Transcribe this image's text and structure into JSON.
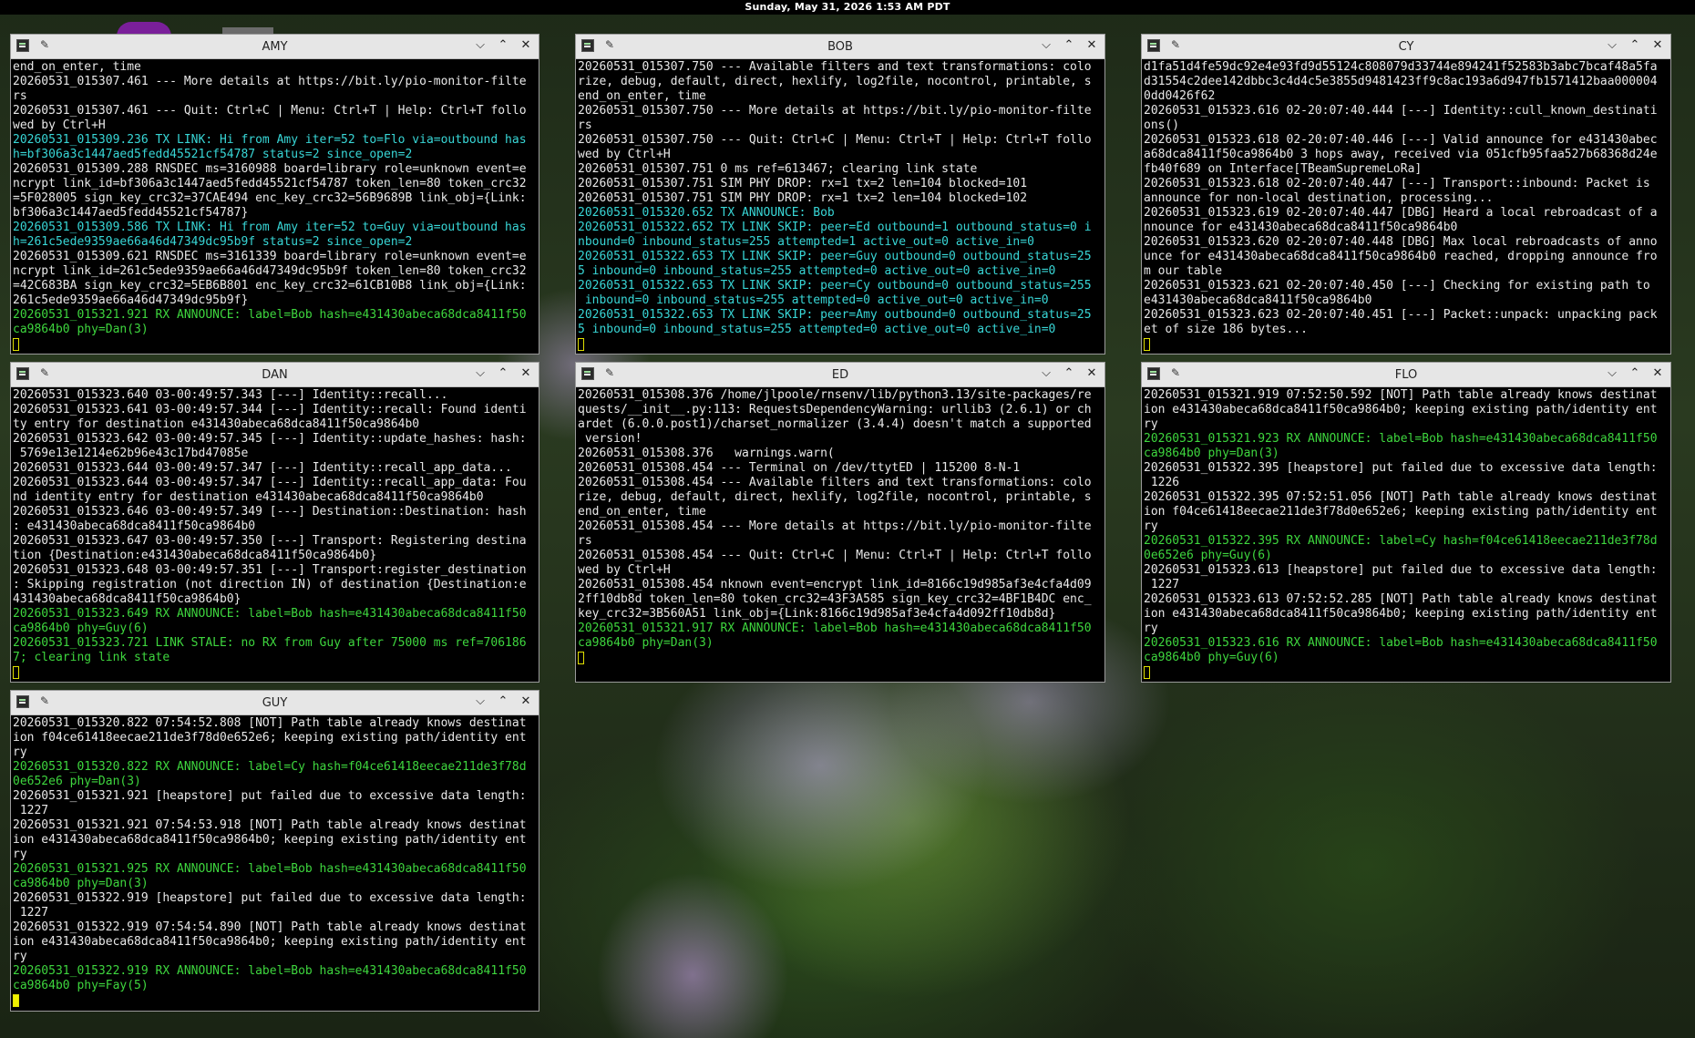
{
  "topbar": {
    "datetime": "Sunday, May 31, 2026  1:53 AM PDT"
  },
  "colors": {
    "cyan": "#38d6d6",
    "green": "#3ed63e",
    "cursor": "#f0f000"
  },
  "icons": [
    "terminal-icon",
    "pin-icon",
    "minimize-icon",
    "maximize-icon",
    "close-icon"
  ],
  "window_controls": {
    "minimize": "⌵",
    "maximize": "⌃",
    "close": "✕",
    "pin": "✎"
  },
  "windows": {
    "amy": {
      "title": "AMY",
      "lines": [
        {
          "t": "end_on_enter, time",
          "c": ""
        },
        {
          "t": "20260531_015307.461 --- More details at https://bit.ly/pio-monitor-filte",
          "c": ""
        },
        {
          "t": "rs",
          "c": ""
        },
        {
          "t": "20260531_015307.461 --- Quit: Ctrl+C | Menu: Ctrl+T | Help: Ctrl+T follo",
          "c": ""
        },
        {
          "t": "wed by Ctrl+H",
          "c": ""
        },
        {
          "t": "20260531_015309.236 TX LINK: Hi from Amy iter=52 to=Flo via=outbound has",
          "c": "c"
        },
        {
          "t": "h=bf306a3c1447aed5fedd45521cf54787 status=2 since_open=2",
          "c": "c"
        },
        {
          "t": "20260531_015309.288 RNSDEC ms=3160988 board=library role=unknown event=e",
          "c": ""
        },
        {
          "t": "ncrypt link_id=bf306a3c1447aed5fedd45521cf54787 token_len=80 token_crc32",
          "c": ""
        },
        {
          "t": "=5F028005 sign_key_crc32=37CAE494 enc_key_crc32=56B9689B link_obj={Link:",
          "c": ""
        },
        {
          "t": "bf306a3c1447aed5fedd45521cf54787}",
          "c": ""
        },
        {
          "t": "20260531_015309.586 TX LINK: Hi from Amy iter=52 to=Guy via=outbound has",
          "c": "c"
        },
        {
          "t": "h=261c5ede9359ae66a46d47349dc95b9f status=2 since_open=2",
          "c": "c"
        },
        {
          "t": "20260531_015309.621 RNSDEC ms=3161339 board=library role=unknown event=e",
          "c": ""
        },
        {
          "t": "ncrypt link_id=261c5ede9359ae66a46d47349dc95b9f token_len=80 token_crc32",
          "c": ""
        },
        {
          "t": "=42C683BA sign_key_crc32=5EB6B801 enc_key_crc32=61CB10B8 link_obj={Link:",
          "c": ""
        },
        {
          "t": "261c5ede9359ae66a46d47349dc95b9f}",
          "c": ""
        },
        {
          "t": "20260531_015321.921 RX ANNOUNCE: label=Bob hash=e431430abeca68dca8411f50",
          "c": "g"
        },
        {
          "t": "ca9864b0 phy=Dan(3)",
          "c": "g"
        }
      ]
    },
    "bob": {
      "title": "BOB",
      "lines": [
        {
          "t": "20260531_015307.750 --- Available filters and text transformations: colo",
          "c": ""
        },
        {
          "t": "rize, debug, default, direct, hexlify, log2file, nocontrol, printable, s",
          "c": ""
        },
        {
          "t": "end_on_enter, time",
          "c": ""
        },
        {
          "t": "20260531_015307.750 --- More details at https://bit.ly/pio-monitor-filte",
          "c": ""
        },
        {
          "t": "rs",
          "c": ""
        },
        {
          "t": "20260531_015307.750 --- Quit: Ctrl+C | Menu: Ctrl+T | Help: Ctrl+T follo",
          "c": ""
        },
        {
          "t": "wed by Ctrl+H",
          "c": ""
        },
        {
          "t": "20260531_015307.751 0 ms ref=613467; clearing link state",
          "c": ""
        },
        {
          "t": "20260531_015307.751 SIM PHY DROP: rx=1 tx=2 len=104 blocked=101",
          "c": ""
        },
        {
          "t": "20260531_015307.751 SIM PHY DROP: rx=1 tx=2 len=104 blocked=102",
          "c": ""
        },
        {
          "t": "20260531_015320.652 TX ANNOUNCE: Bob",
          "c": "c"
        },
        {
          "t": "20260531_015322.652 TX LINK SKIP: peer=Ed outbound=1 outbound_status=0 i",
          "c": "c"
        },
        {
          "t": "nbound=0 inbound_status=255 attempted=1 active_out=0 active_in=0",
          "c": "c"
        },
        {
          "t": "20260531_015322.653 TX LINK SKIP: peer=Guy outbound=0 outbound_status=25",
          "c": "c"
        },
        {
          "t": "5 inbound=0 inbound_status=255 attempted=0 active_out=0 active_in=0",
          "c": "c"
        },
        {
          "t": "20260531_015322.653 TX LINK SKIP: peer=Cy outbound=0 outbound_status=255",
          "c": "c"
        },
        {
          "t": " inbound=0 inbound_status=255 attempted=0 active_out=0 active_in=0",
          "c": "c"
        },
        {
          "t": "20260531_015322.653 TX LINK SKIP: peer=Amy outbound=0 outbound_status=25",
          "c": "c"
        },
        {
          "t": "5 inbound=0 inbound_status=255 attempted=0 active_out=0 active_in=0",
          "c": "c"
        }
      ]
    },
    "cy": {
      "title": "CY",
      "lines": [
        {
          "t": "d1fa51d4fe59dc92e4e93fd9d55124c808079d33744e894241f52583b3abc7bcaf48a5fa",
          "c": ""
        },
        {
          "t": "d31554c2dee142dbbc3c4d4c5e3855d9481423ff9c8ac193a6d947fb1571412baa000004",
          "c": ""
        },
        {
          "t": "0dd0426f62",
          "c": ""
        },
        {
          "t": "20260531_015323.616 02-20:07:40.444 [---] Identity::cull_known_destinati",
          "c": ""
        },
        {
          "t": "ons()",
          "c": ""
        },
        {
          "t": "20260531_015323.618 02-20:07:40.446 [---] Valid announce for e431430abec",
          "c": ""
        },
        {
          "t": "a68dca8411f50ca9864b0 3 hops away, received via 051cfb95faa527b68368d24e",
          "c": ""
        },
        {
          "t": "fb40f689 on Interface[TBeamSupremeLoRa]",
          "c": ""
        },
        {
          "t": "20260531_015323.618 02-20:07:40.447 [---] Transport::inbound: Packet is",
          "c": ""
        },
        {
          "t": "announce for non-local destination, processing...",
          "c": ""
        },
        {
          "t": "20260531_015323.619 02-20:07:40.447 [DBG] Heard a local rebroadcast of a",
          "c": ""
        },
        {
          "t": "nnounce for e431430abeca68dca8411f50ca9864b0",
          "c": ""
        },
        {
          "t": "20260531_015323.620 02-20:07:40.448 [DBG] Max local rebroadcasts of anno",
          "c": ""
        },
        {
          "t": "unce for e431430abeca68dca8411f50ca9864b0 reached, dropping announce fro",
          "c": ""
        },
        {
          "t": "m our table",
          "c": ""
        },
        {
          "t": "20260531_015323.621 02-20:07:40.450 [---] Checking for existing path to",
          "c": ""
        },
        {
          "t": "e431430abeca68dca8411f50ca9864b0",
          "c": ""
        },
        {
          "t": "20260531_015323.623 02-20:07:40.451 [---] Packet::unpack: unpacking pack",
          "c": ""
        },
        {
          "t": "et of size 186 bytes...",
          "c": ""
        }
      ]
    },
    "dan": {
      "title": "DAN",
      "lines": [
        {
          "t": "20260531_015323.640 03-00:49:57.343 [---] Identity::recall...",
          "c": ""
        },
        {
          "t": "20260531_015323.641 03-00:49:57.344 [---] Identity::recall: Found identi",
          "c": ""
        },
        {
          "t": "ty entry for destination e431430abeca68dca8411f50ca9864b0",
          "c": ""
        },
        {
          "t": "20260531_015323.642 03-00:49:57.345 [---] Identity::update_hashes: hash:",
          "c": ""
        },
        {
          "t": " 5769e13e1214e62b96e43c17bd47085e",
          "c": ""
        },
        {
          "t": "20260531_015323.644 03-00:49:57.347 [---] Identity::recall_app_data...",
          "c": ""
        },
        {
          "t": "20260531_015323.644 03-00:49:57.347 [---] Identity::recall_app_data: Fou",
          "c": ""
        },
        {
          "t": "nd identity entry for destination e431430abeca68dca8411f50ca9864b0",
          "c": ""
        },
        {
          "t": "20260531_015323.646 03-00:49:57.349 [---] Destination::Destination: hash",
          "c": ""
        },
        {
          "t": ": e431430abeca68dca8411f50ca9864b0",
          "c": ""
        },
        {
          "t": "20260531_015323.647 03-00:49:57.350 [---] Transport: Registering destina",
          "c": ""
        },
        {
          "t": "tion {Destination:e431430abeca68dca8411f50ca9864b0}",
          "c": ""
        },
        {
          "t": "20260531_015323.648 03-00:49:57.351 [---] Transport:register_destination",
          "c": ""
        },
        {
          "t": ": Skipping registration (not direction IN) of destination {Destination:e",
          "c": ""
        },
        {
          "t": "431430abeca68dca8411f50ca9864b0}",
          "c": ""
        },
        {
          "t": "20260531_015323.649 RX ANNOUNCE: label=Bob hash=e431430abeca68dca8411f50",
          "c": "g"
        },
        {
          "t": "ca9864b0 phy=Guy(6)",
          "c": "g"
        },
        {
          "t": "20260531_015323.721 LINK STALE: no RX from Guy after 75000 ms ref=706186",
          "c": "g"
        },
        {
          "t": "7; clearing link state",
          "c": "g"
        }
      ]
    },
    "ed": {
      "title": "ED",
      "lines": [
        {
          "t": "20260531_015308.376 /home/jlpoole/rnsenv/lib/python3.13/site-packages/re",
          "c": ""
        },
        {
          "t": "quests/__init__.py:113: RequestsDependencyWarning: urllib3 (2.6.1) or ch",
          "c": ""
        },
        {
          "t": "ardet (6.0.0.post1)/charset_normalizer (3.4.4) doesn't match a supported",
          "c": ""
        },
        {
          "t": " version!",
          "c": ""
        },
        {
          "t": "20260531_015308.376   warnings.warn(",
          "c": ""
        },
        {
          "t": "20260531_015308.454 --- Terminal on /dev/ttytED | 115200 8-N-1",
          "c": ""
        },
        {
          "t": "20260531_015308.454 --- Available filters and text transformations: colo",
          "c": ""
        },
        {
          "t": "rize, debug, default, direct, hexlify, log2file, nocontrol, printable, s",
          "c": ""
        },
        {
          "t": "end_on_enter, time",
          "c": ""
        },
        {
          "t": "20260531_015308.454 --- More details at https://bit.ly/pio-monitor-filte",
          "c": ""
        },
        {
          "t": "rs",
          "c": ""
        },
        {
          "t": "20260531_015308.454 --- Quit: Ctrl+C | Menu: Ctrl+T | Help: Ctrl+T follo",
          "c": ""
        },
        {
          "t": "wed by Ctrl+H",
          "c": ""
        },
        {
          "t": "20260531_015308.454 nknown event=encrypt link_id=8166c19d985af3e4cfa4d09",
          "c": ""
        },
        {
          "t": "2ff10db8d token_len=80 token_crc32=43F3A585 sign_key_crc32=4BF1B4DC enc_",
          "c": ""
        },
        {
          "t": "key_crc32=3B560A51 link_obj={Link:8166c19d985af3e4cfa4d092ff10db8d}",
          "c": ""
        },
        {
          "t": "20260531_015321.917 RX ANNOUNCE: label=Bob hash=e431430abeca68dca8411f50",
          "c": "g"
        },
        {
          "t": "ca9864b0 phy=Dan(3)",
          "c": "g"
        }
      ]
    },
    "flo": {
      "title": "FLO",
      "lines": [
        {
          "t": "20260531_015321.919 07:52:50.592 [NOT] Path table already knows destinat",
          "c": ""
        },
        {
          "t": "ion e431430abeca68dca8411f50ca9864b0; keeping existing path/identity ent",
          "c": ""
        },
        {
          "t": "ry",
          "c": ""
        },
        {
          "t": "20260531_015321.923 RX ANNOUNCE: label=Bob hash=e431430abeca68dca8411f50",
          "c": "g"
        },
        {
          "t": "ca9864b0 phy=Dan(3)",
          "c": "g"
        },
        {
          "t": "20260531_015322.395 [heapstore] put failed due to excessive data length:",
          "c": ""
        },
        {
          "t": " 1226",
          "c": ""
        },
        {
          "t": "20260531_015322.395 07:52:51.056 [NOT] Path table already knows destinat",
          "c": ""
        },
        {
          "t": "ion f04ce61418eecae211de3f78d0e652e6; keeping existing path/identity ent",
          "c": ""
        },
        {
          "t": "ry",
          "c": ""
        },
        {
          "t": "20260531_015322.395 RX ANNOUNCE: label=Cy hash=f04ce61418eecae211de3f78d",
          "c": "g"
        },
        {
          "t": "0e652e6 phy=Guy(6)",
          "c": "g"
        },
        {
          "t": "20260531_015323.613 [heapstore] put failed due to excessive data length:",
          "c": ""
        },
        {
          "t": " 1227",
          "c": ""
        },
        {
          "t": "20260531_015323.613 07:52:52.285 [NOT] Path table already knows destinat",
          "c": ""
        },
        {
          "t": "ion e431430abeca68dca8411f50ca9864b0; keeping existing path/identity ent",
          "c": ""
        },
        {
          "t": "ry",
          "c": ""
        },
        {
          "t": "20260531_015323.616 RX ANNOUNCE: label=Bob hash=e431430abeca68dca8411f50",
          "c": "g"
        },
        {
          "t": "ca9864b0 phy=Guy(6)",
          "c": "g"
        }
      ]
    },
    "guy": {
      "title": "GUY",
      "lines": [
        {
          "t": "20260531_015320.822 07:54:52.808 [NOT] Path table already knows destinat",
          "c": ""
        },
        {
          "t": "ion f04ce61418eecae211de3f78d0e652e6; keeping existing path/identity ent",
          "c": ""
        },
        {
          "t": "ry",
          "c": ""
        },
        {
          "t": "20260531_015320.822 RX ANNOUNCE: label=Cy hash=f04ce61418eecae211de3f78d",
          "c": "g"
        },
        {
          "t": "0e652e6 phy=Dan(3)",
          "c": "g"
        },
        {
          "t": "20260531_015321.921 [heapstore] put failed due to excessive data length:",
          "c": ""
        },
        {
          "t": " 1227",
          "c": ""
        },
        {
          "t": "20260531_015321.921 07:54:53.918 [NOT] Path table already knows destinat",
          "c": ""
        },
        {
          "t": "ion e431430abeca68dca8411f50ca9864b0; keeping existing path/identity ent",
          "c": ""
        },
        {
          "t": "ry",
          "c": ""
        },
        {
          "t": "20260531_015321.925 RX ANNOUNCE: label=Bob hash=e431430abeca68dca8411f50",
          "c": "g"
        },
        {
          "t": "ca9864b0 phy=Dan(3)",
          "c": "g"
        },
        {
          "t": "20260531_015322.919 [heapstore] put failed due to excessive data length:",
          "c": ""
        },
        {
          "t": " 1227",
          "c": ""
        },
        {
          "t": "20260531_015322.919 07:54:54.890 [NOT] Path table already knows destinat",
          "c": ""
        },
        {
          "t": "ion e431430abeca68dca8411f50ca9864b0; keeping existing path/identity ent",
          "c": ""
        },
        {
          "t": "ry",
          "c": ""
        },
        {
          "t": "20260531_015322.919 RX ANNOUNCE: label=Bob hash=e431430abeca68dca8411f50",
          "c": "g"
        },
        {
          "t": "ca9864b0 phy=Fay(5)",
          "c": "g"
        }
      ]
    }
  }
}
